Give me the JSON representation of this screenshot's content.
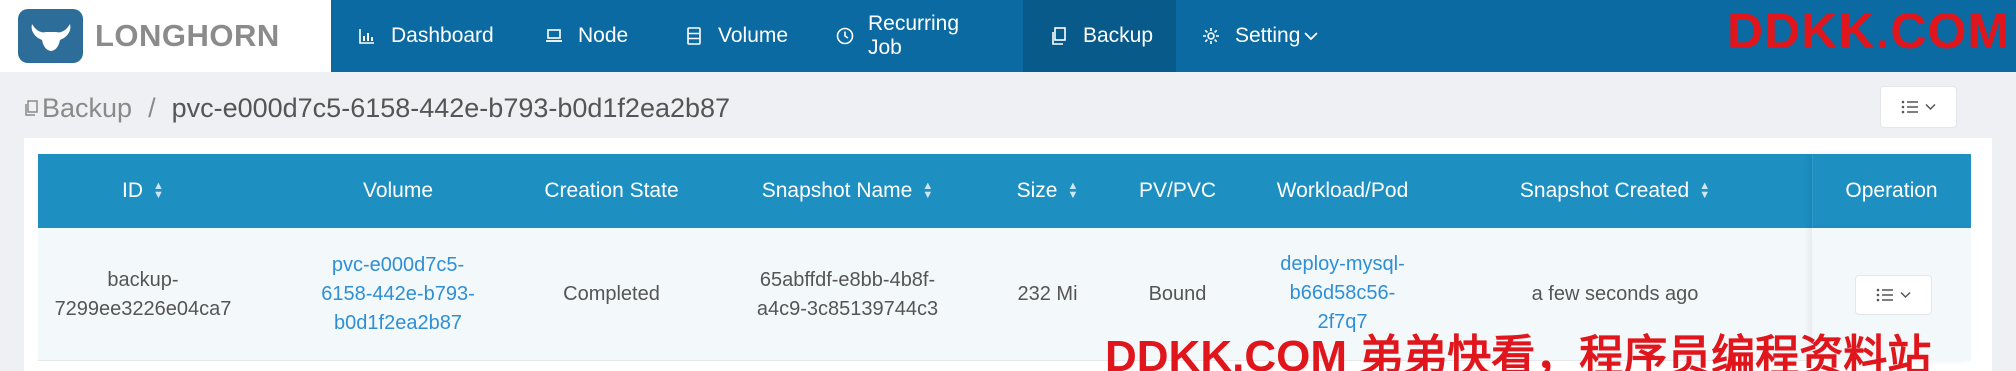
{
  "brand": {
    "name": "LONGHORN"
  },
  "nav": {
    "items": [
      {
        "label": "Dashboard",
        "icon": "bar-chart-icon"
      },
      {
        "label": "Node",
        "icon": "laptop-icon"
      },
      {
        "label": "Volume",
        "icon": "database-icon"
      },
      {
        "label": "Recurring Job",
        "icon": "clock-icon"
      },
      {
        "label": "Backup",
        "icon": "copy-icon",
        "active": true
      },
      {
        "label": "Setting",
        "icon": "gear-icon"
      }
    ]
  },
  "watermark": {
    "top": "DDKK.COM",
    "bottom": "DDKK.COM 弟弟快看，程序员编程资料站"
  },
  "breadcrumb": {
    "root": "Backup",
    "separator": "/",
    "current": "pvc-e000d7c5-6158-442e-b793-b0d1f2ea2b87"
  },
  "table": {
    "columns": [
      "ID",
      "Volume",
      "Creation State",
      "Snapshot Name",
      "Size",
      "PV/PVC",
      "Workload/Pod",
      "Snapshot Created",
      "Operation"
    ],
    "rows": [
      {
        "id_line1": "backup-",
        "id_line2": "7299ee3226e04ca7",
        "volume_line1": "pvc-e000d7c5-",
        "volume_line2": "6158-442e-b793-",
        "volume_line3": "b0d1f2ea2b87",
        "creation_state": "Completed",
        "snapshot_line1": "65abffdf-e8bb-4b8f-",
        "snapshot_line2": "a4c9-3c85139744c3",
        "size": "232 Mi",
        "pv_pvc": "Bound",
        "workload_line1": "deploy-mysql-",
        "workload_line2": "b66d58c56-",
        "workload_line3": "2f7q7",
        "snapshot_created": "a few seconds ago"
      }
    ]
  },
  "colors": {
    "nav_bg": "#0a6aa1",
    "nav_active": "#085a8b",
    "table_header": "#1d8fc1",
    "link": "#2f8fd6",
    "watermark": "#e0161c"
  }
}
